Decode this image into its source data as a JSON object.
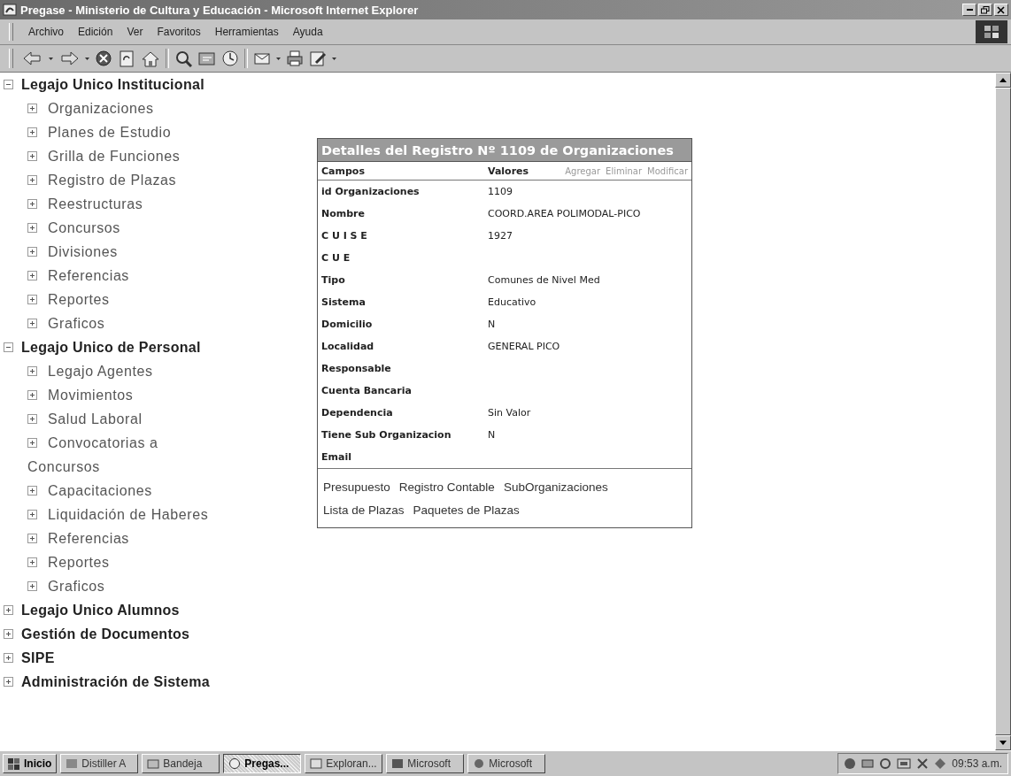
{
  "window": {
    "title": "Pregase - Ministerio de Cultura y Educación - Microsoft Internet Explorer"
  },
  "menu": [
    "Archivo",
    "Edición",
    "Ver",
    "Favoritos",
    "Herramientas",
    "Ayuda"
  ],
  "tree": [
    {
      "label": "Legajo Unico Institucional",
      "expanded": true,
      "children": [
        {
          "label": "Organizaciones",
          "expanded": false
        },
        {
          "label": "Planes de Estudio",
          "expanded": false
        },
        {
          "label": "Grilla de Funciones",
          "expanded": false
        },
        {
          "label": "Registro de Plazas",
          "expanded": false
        },
        {
          "label": "Reestructuras",
          "expanded": false
        },
        {
          "label": "Concursos",
          "expanded": false
        },
        {
          "label": "Divisiones",
          "expanded": false
        },
        {
          "label": "Referencias",
          "expanded": false
        },
        {
          "label": "Reportes",
          "expanded": false
        },
        {
          "label": "Graficos",
          "expanded": false
        }
      ]
    },
    {
      "label": "Legajo Unico de Personal",
      "expanded": true,
      "children": [
        {
          "label": "Legajo Agentes",
          "expanded": false
        },
        {
          "label": "Movimientos",
          "expanded": false
        },
        {
          "label": "Salud Laboral",
          "expanded": false
        },
        {
          "label": "Convocatorias a Concursos",
          "expanded": false
        },
        {
          "label": "Capacitaciones",
          "expanded": false
        },
        {
          "label": "Liquidación de Haberes",
          "expanded": false
        },
        {
          "label": "Referencias",
          "expanded": false
        },
        {
          "label": "Reportes",
          "expanded": false
        },
        {
          "label": "Graficos",
          "expanded": false
        }
      ]
    },
    {
      "label": "Legajo Unico Alumnos",
      "expanded": false
    },
    {
      "label": "Gestión de Documentos",
      "expanded": false
    },
    {
      "label": "SIPE",
      "expanded": false
    },
    {
      "label": "Administración de Sistema",
      "expanded": false
    }
  ],
  "record": {
    "title": "Detalles del Registro Nº 1109 de Organizaciones",
    "columns": [
      "Campos",
      "Valores"
    ],
    "actions": [
      "Agregar",
      "Eliminar",
      "Modificar"
    ],
    "rows": [
      {
        "field": "id Organizaciones",
        "value": "1109"
      },
      {
        "field": "Nombre",
        "value": "COORD.AREA POLIMODAL-PICO"
      },
      {
        "field": "C U I S E",
        "value": "1927"
      },
      {
        "field": "C U E"
      },
      {
        "field": "Tipo",
        "value": "Comunes de Nivel Med"
      },
      {
        "field": "Sistema",
        "value": "Educativo"
      },
      {
        "field": "Domicilio",
        "value": "N"
      },
      {
        "field": "Localidad",
        "value": "GENERAL PICO"
      },
      {
        "field": "Responsable"
      },
      {
        "field": "Cuenta Bancaria"
      },
      {
        "field": "Dependencia",
        "value": "Sin Valor"
      },
      {
        "field": "Tiene Sub Organizacion",
        "value": "N"
      },
      {
        "field": "Email"
      }
    ],
    "links": [
      "Presupuesto",
      "Registro Contable",
      "SubOrganizaciones",
      "Lista de Plazas",
      "Paquetes de Plazas"
    ]
  },
  "taskbar": {
    "start": "Inicio",
    "tasks": [
      {
        "label": "Distiller A",
        "selected": false
      },
      {
        "label": "Bandeja",
        "selected": false
      },
      {
        "label": "Pregas...",
        "selected": true
      },
      {
        "label": "Exploran...",
        "selected": false
      },
      {
        "label": "Microsoft",
        "selected": false
      },
      {
        "label": "Microsoft",
        "selected": false
      }
    ],
    "clock": "09:53 a.m."
  }
}
